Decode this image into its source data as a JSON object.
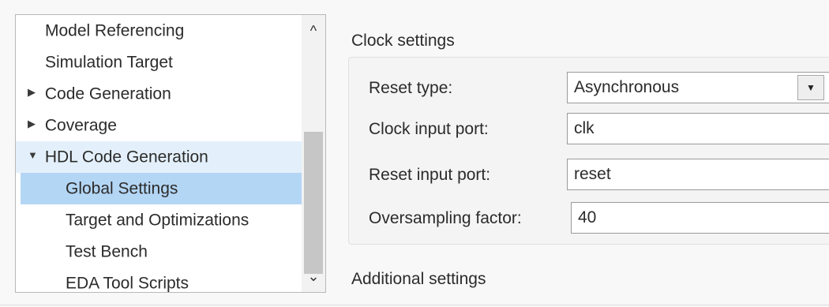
{
  "tree": {
    "items": [
      {
        "label": "Model Referencing",
        "arrow": ""
      },
      {
        "label": "Simulation Target",
        "arrow": ""
      },
      {
        "label": "Code Generation",
        "arrow": "▶"
      },
      {
        "label": "Coverage",
        "arrow": "▶"
      },
      {
        "label": "HDL Code Generation",
        "arrow": "▼"
      },
      {
        "label": "Global Settings",
        "arrow": ""
      },
      {
        "label": "Target and Optimizations",
        "arrow": ""
      },
      {
        "label": "Test Bench",
        "arrow": ""
      },
      {
        "label": "EDA Tool Scripts",
        "arrow": ""
      }
    ],
    "scroll_up_icon": "^",
    "scroll_down_icon": "⌄"
  },
  "clock_settings": {
    "title": "Clock settings",
    "reset_type_label": "Reset type:",
    "reset_type_value": "Asynchronous",
    "clock_input_port_label": "Clock input port:",
    "clock_input_port_value": "clk",
    "reset_input_port_label": "Reset input port:",
    "reset_input_port_value": "reset",
    "oversampling_factor_label": "Oversampling factor:",
    "oversampling_factor_value": "40"
  },
  "additional_settings": {
    "title": "Additional settings"
  },
  "icons": {
    "dropdown": "▼"
  }
}
